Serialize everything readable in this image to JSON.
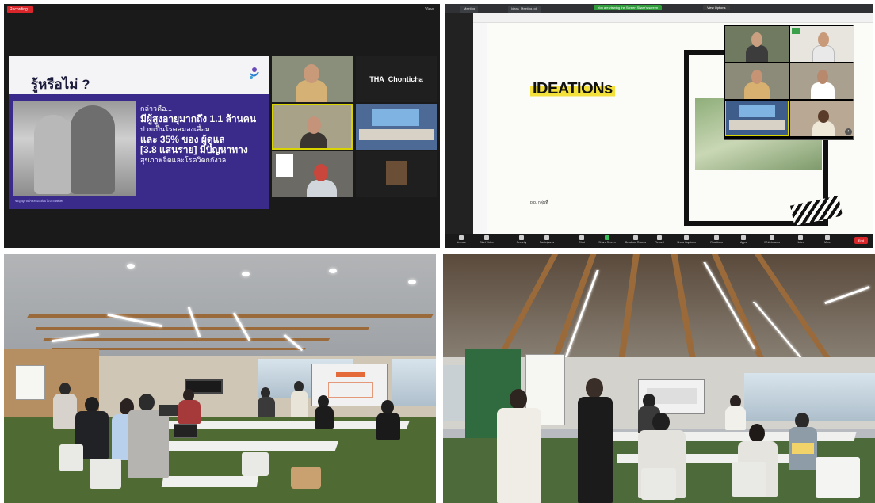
{
  "panel1": {
    "recording_badge": "Recording...",
    "view_label": "View",
    "slide": {
      "title": "รู้หรือไม่ ?",
      "lines": [
        "กล่าวคือ...",
        "มีผู้สูงอายุมากถึง 1.1 ล้านคน",
        "ป่วยเป็นโรคสมองเสื่อม",
        "และ 35% ของ ผู้ดูแล",
        "[3.8 แสนราย] มีปัญหาทาง",
        "สุขภาพจิตและโรควิตกกังวล"
      ],
      "caption": "ข้อมูลผู้ป่วยโรคสมองเสื่อมในประเทศไทย"
    },
    "tile_names": [
      "",
      "THA_Chonticha",
      "",
      "",
      "",
      "",
      "",
      ""
    ],
    "featured_name": "THA_Chonticha"
  },
  "panel2": {
    "tabs": [
      "Meeting",
      "Ideas_Meeting.pdf"
    ],
    "share_banner": "You are viewing the Screen Share's screen",
    "view_options": "View Options",
    "heading": "IDEATIONs",
    "note": "p.p. กลุ่มที่",
    "toolbar": [
      "Unmute",
      "Start Video",
      "Security",
      "Participants",
      "Chat",
      "Share Screen",
      "Breakout Rooms",
      "Record",
      "Show Captions",
      "Reactions",
      "Apps",
      "Whiteboards",
      "Notes",
      "More"
    ],
    "end_label": "End"
  },
  "colors": {
    "slide_purple": "#3a2a8a",
    "ideations_highlight": "#f4e03a",
    "zoom_red": "#d8262b",
    "zoom_green": "#2e9d3a"
  }
}
